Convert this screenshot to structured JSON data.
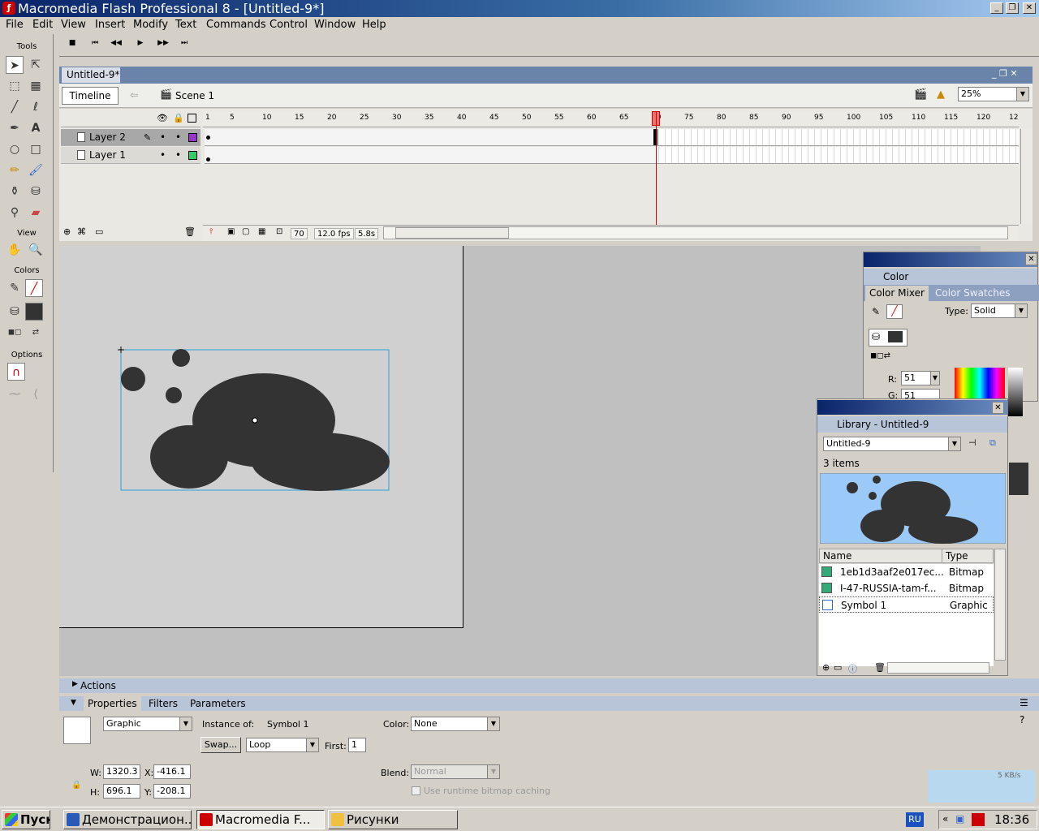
{
  "window": {
    "title": "Macromedia Flash Professional 8 - [Untitled-9*]"
  },
  "menu": [
    "File",
    "Edit",
    "View",
    "Insert",
    "Modify",
    "Text",
    "Commands",
    "Control",
    "Window",
    "Help"
  ],
  "controller": {
    "buttons": [
      "■",
      "⏮",
      "◀◀",
      "▶",
      "▶▶",
      "⏭"
    ]
  },
  "tools": {
    "header": "Tools",
    "view": "View",
    "colors": "Colors",
    "options": "Options"
  },
  "document": {
    "tab": "Untitled-9*",
    "timeline_label": "Timeline",
    "scene": "Scene 1",
    "zoom": "25%"
  },
  "timeline": {
    "ruler": [
      "1",
      "5",
      "10",
      "15",
      "20",
      "25",
      "30",
      "35",
      "40",
      "45",
      "50",
      "55",
      "60",
      "65",
      "70",
      "75",
      "80",
      "85",
      "90",
      "95",
      "100",
      "105",
      "110",
      "115",
      "120",
      "12"
    ],
    "layers": [
      {
        "name": "Layer 2",
        "color": "#9933cc"
      },
      {
        "name": "Layer 1",
        "color": "#33cc66"
      }
    ],
    "current_frame": "70",
    "fps": "12.0 fps",
    "time": "5.8s"
  },
  "color_panel": {
    "title": "Color",
    "tab_mixer": "Color Mixer",
    "tab_swatches": "Color Swatches",
    "type_label": "Type:",
    "type_value": "Solid",
    "r_label": "R:",
    "r_value": "51",
    "g_label": "G:",
    "g_value": "51"
  },
  "library": {
    "title": "Library - Untitled-9",
    "doc": "Untitled-9",
    "count": "3 items",
    "col_name": "Name",
    "col_type": "Type",
    "items": [
      {
        "name": "1eb1d3aaf2e017ec...",
        "type": "Bitmap"
      },
      {
        "name": "I-47-RUSSIA-tam-f...",
        "type": "Bitmap"
      },
      {
        "name": "Symbol 1",
        "type": "Graphic"
      }
    ]
  },
  "properties": {
    "actions": "Actions",
    "tab_properties": "Properties",
    "tab_filters": "Filters",
    "tab_parameters": "Parameters",
    "symbol_type": "Graphic",
    "instance_label": "Instance of:",
    "instance_value": "Symbol 1",
    "swap": "Swap...",
    "loop": "Loop",
    "first_label": "First:",
    "first_value": "1",
    "color_label": "Color:",
    "color_value": "None",
    "w_label": "W:",
    "w_value": "1320.3",
    "h_label": "H:",
    "h_value": "696.1",
    "x_label": "X:",
    "x_value": "-416.1",
    "y_label": "Y:",
    "y_value": "-208.1",
    "blend_label": "Blend:",
    "blend_value": "Normal",
    "cache_label": "Use runtime bitmap caching",
    "net_speed": "5 KB/s"
  },
  "taskbar": {
    "start": "Пуск",
    "tasks": [
      "Демонстрацион...",
      "Macromedia F...",
      "Рисунки"
    ],
    "lang": "RU",
    "clock": "18:36"
  }
}
